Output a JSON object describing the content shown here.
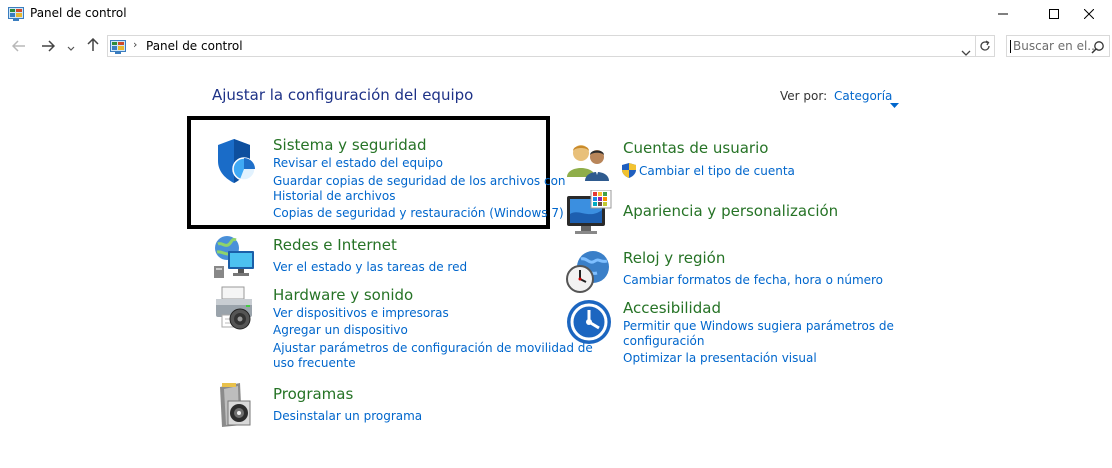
{
  "window": {
    "title": "Panel de control",
    "minimize_icon": "minimize-icon",
    "maximize_icon": "maximize-icon",
    "close_icon": "close-icon"
  },
  "navigation": {
    "back_icon": "back-arrow-icon",
    "forward_icon": "forward-arrow-icon",
    "recent_icon": "chevron-down-icon",
    "up_icon": "up-arrow-icon"
  },
  "address": {
    "separator": "›",
    "path": "Panel de control",
    "refresh_icon": "refresh-icon"
  },
  "search": {
    "placeholder": "Buscar en el..."
  },
  "main": {
    "heading": "Ajustar la configuración del equipo",
    "view_by_label": "Ver por:",
    "view_by_value": "Categoría"
  },
  "categories": {
    "system": {
      "title": "Sistema y seguridad",
      "links": [
        "Revisar el estado del equipo",
        "Guardar copias de seguridad de los archivos con",
        "Historial de archivos",
        "Copias de seguridad y restauración (Windows 7)"
      ]
    },
    "network": {
      "title": "Redes e Internet",
      "links": [
        "Ver el estado y las tareas de red"
      ]
    },
    "hardware": {
      "title": "Hardware y sonido",
      "links": [
        "Ver dispositivos e impresoras",
        "Agregar un dispositivo",
        "Ajustar parámetros de configuración de movilidad de",
        "uso frecuente"
      ]
    },
    "programs": {
      "title": "Programas",
      "links": [
        "Desinstalar un programa"
      ]
    },
    "users": {
      "title": "Cuentas de usuario",
      "links": [
        "Cambiar el tipo de cuenta"
      ]
    },
    "appearance": {
      "title": "Apariencia y personalización",
      "links": []
    },
    "clock": {
      "title": "Reloj y región",
      "links": [
        "Cambiar formatos de fecha, hora o número"
      ]
    },
    "access": {
      "title": "Accesibilidad",
      "links": [
        "Permitir que Windows sugiera parámetros de",
        "configuración",
        "Optimizar la presentación visual"
      ]
    }
  },
  "colors": {
    "heading": "#1e3287",
    "category_title": "#267326",
    "link": "#0066cc",
    "highlight_border": "#000000"
  }
}
